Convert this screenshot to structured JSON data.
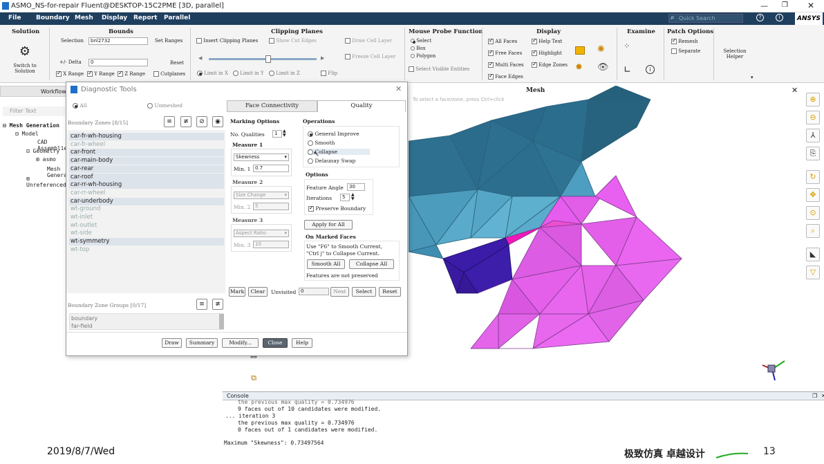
{
  "window": {
    "title": "ASMO_NS-for-repair Fluent@DESKTOP-15C2PME [3D, parallel]",
    "search_placeholder": "Quick Search",
    "brand": "ANSYS"
  },
  "menu": [
    "File",
    "Boundary",
    "Mesh",
    "Display",
    "Report",
    "Parallel"
  ],
  "ribbon": {
    "solution": {
      "title": "Solution",
      "switch_label": "Switch to\nSolution"
    },
    "bounds": {
      "title": "Bounds",
      "selection_label": "Selection",
      "selection_value": "bnl2732",
      "set_ranges": "Set Ranges",
      "delta_label": "+/- Delta",
      "delta_value": "0",
      "reset": "Reset",
      "x_range": "X Range",
      "y_range": "Y Range",
      "z_range": "Z Range",
      "cutplanes": "Cutplanes"
    },
    "clipping": {
      "title": "Clipping Planes",
      "insert": "Insert Clipping Planes",
      "show_cut": "Show Cut Edges",
      "draw_cell": "Draw Cell Layer",
      "freeze_cell": "Freeze Cell Layer",
      "limit_x": "Limit in X",
      "limit_y": "Limit in Y",
      "limit_z": "Limit in Z",
      "flip": "Flip",
      "slider_value": 0.55
    },
    "probe": {
      "title": "Mouse Probe Function",
      "select": "Select",
      "box": "Box",
      "polygon": "Polygon",
      "select_visible": "Select Visible Entities"
    },
    "display": {
      "title": "Display",
      "all_faces": "All Faces",
      "free_faces": "Free Faces",
      "multi_faces": "Multi Faces",
      "face_edges": "Face Edges",
      "help_text": "Help Text",
      "highlight": "Highlight",
      "edge_zones": "Edge Zones"
    },
    "examine": {
      "title": "Examine"
    },
    "patch": {
      "title": "Patch Options",
      "remesh": "Remesh",
      "separate": "Separate",
      "helper": "Selection\nHelper"
    }
  },
  "left_panel": {
    "tab": "Workflow",
    "filter_placeholder": "Filter Text",
    "tree": [
      "Mesh Generation",
      "Model",
      "CAD Assemblies",
      "Geometry",
      "asmo",
      "Mesh Generation",
      "Unreferenced"
    ]
  },
  "viewport": {
    "title": "Mesh",
    "hint": "To select a face/zone, press Ctrl+click"
  },
  "dialog": {
    "title": "Diagnostic Tools",
    "all": "All",
    "unmeshed": "Unmeshed",
    "zones_label": "Boundary Zones [8/15]",
    "zones": [
      {
        "name": "car-fr-wh-housing",
        "state": "sel"
      },
      {
        "name": "car-fr-wheel",
        "state": "dim"
      },
      {
        "name": "car-front",
        "state": "sel"
      },
      {
        "name": "car-main-body",
        "state": "sel"
      },
      {
        "name": "car-rear",
        "state": "sel"
      },
      {
        "name": "car-roof",
        "state": "sel"
      },
      {
        "name": "car-rr-wh-housing",
        "state": "sel"
      },
      {
        "name": "car-rr-wheel",
        "state": "dim"
      },
      {
        "name": "car-underbody",
        "state": "sel"
      },
      {
        "name": "wt-ground",
        "state": "dim"
      },
      {
        "name": "wt-inlet",
        "state": "dim"
      },
      {
        "name": "wt-outlet",
        "state": "dim"
      },
      {
        "name": "wt-side",
        "state": "dim"
      },
      {
        "name": "wt-symmetry",
        "state": "sel"
      },
      {
        "name": "wt-top",
        "state": "dim"
      }
    ],
    "groups_label": "Boundary Zone Groups [0/17]",
    "groups": [
      "boundary",
      "far-field"
    ],
    "tabs": [
      "Face Connectivity",
      "Quality"
    ],
    "marking": {
      "title": "Marking Options",
      "no_qualities": "No. Qualities",
      "no_qualities_value": "1",
      "measure1": "Measure 1",
      "m1_value": "Skewness",
      "min1_label": "Min. 1",
      "min1_value": "0.7",
      "measure2": "Measure 2",
      "m2_value": "Size Change",
      "min2_label": "Min. 2",
      "min2_value": "5",
      "measure3": "Measure 3",
      "m3_value": "Aspect Ratio",
      "min3_label": "Min. 3",
      "min3_value": "10"
    },
    "operations": {
      "title": "Operations",
      "items": [
        "General Improve",
        "Smooth",
        "Collapse",
        "Delaunay Swap"
      ]
    },
    "options": {
      "title": "Options",
      "feature_angle": "Feature Angle",
      "feature_angle_value": "30",
      "iterations": "Iterations",
      "iterations_value": "5",
      "preserve": "Preserve Boundary",
      "apply_all": "Apply for All"
    },
    "marked": {
      "title": "On Marked Faces",
      "hint": "Use \"F6\" to Smooth Current,\n\"Ctrl j\" to Collapse Current.",
      "smooth_all": "Smooth All",
      "collapse_all": "Collapse All",
      "note": "Features are not preserved"
    },
    "bottom_row": {
      "mark": "Mark",
      "clear": "Clear",
      "unvisited": "Unvisited",
      "unvisited_value": "0",
      "next": "Next",
      "select": "Select",
      "reset": "Reset"
    },
    "footer": [
      "Draw",
      "Summary",
      "Modify...",
      "Close",
      "Help"
    ]
  },
  "console": {
    "title": "Console",
    "lines": [
      "the previous max quality = 0.734976",
      "9 faces out of 10 candidates were modified.",
      "... iteration 3",
      "the previous max quality = 0.734976",
      "0 faces out of 1 candidates were modified.",
      "",
      "Maximum \"Skewness\": 0.73497564"
    ]
  },
  "overlay": {
    "date": "2019/8/7/Wed",
    "slogan": "极致仿真 卓越设计",
    "page": "13"
  }
}
